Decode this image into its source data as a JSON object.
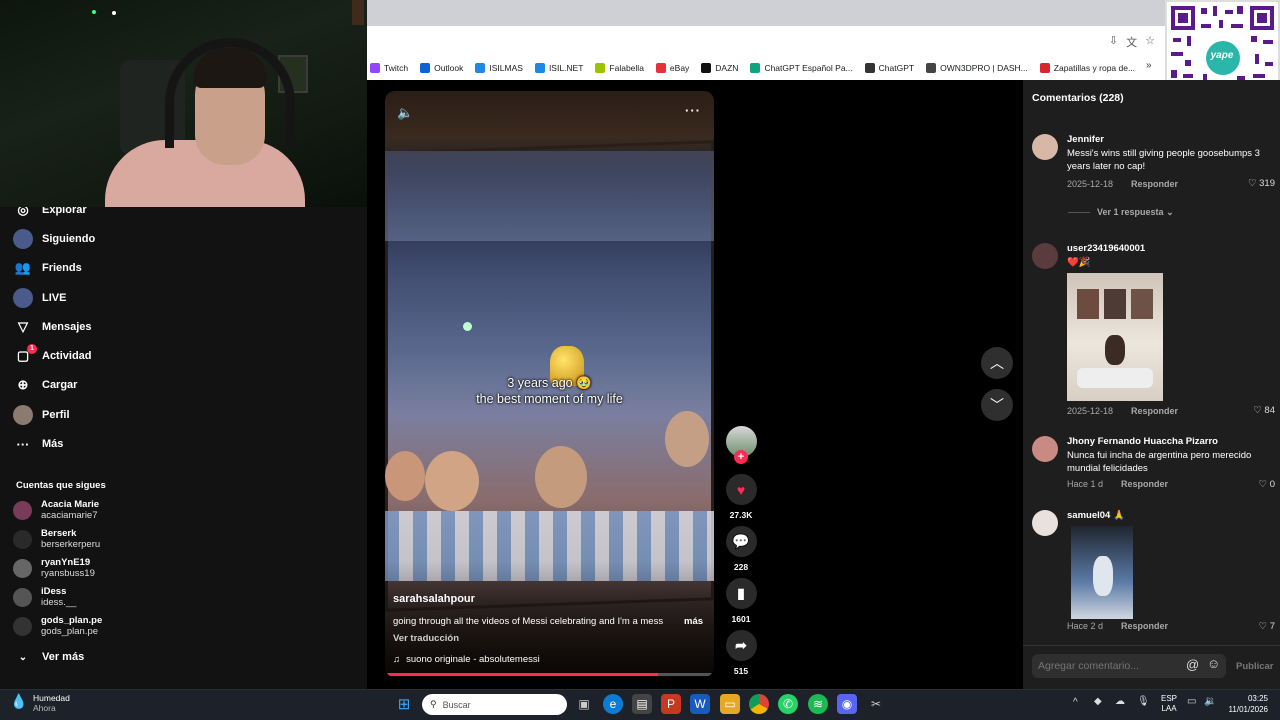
{
  "bookmarks": [
    {
      "label": "Twitch",
      "color": "#9146ff"
    },
    {
      "label": "Outlook",
      "color": "#0a64d4"
    },
    {
      "label": "ISILMAS",
      "color": "#1e88e5"
    },
    {
      "label": "ISIL.NET",
      "color": "#1e88e5"
    },
    {
      "label": "Falabella",
      "color": "#9bc400"
    },
    {
      "label": "eBay",
      "color": "#e53238"
    },
    {
      "label": "DAZN",
      "color": "#111111"
    },
    {
      "label": "ChatGPT Español Pa...",
      "color": "#10a37f"
    },
    {
      "label": "ChatGPT",
      "color": "#333333"
    },
    {
      "label": "OWN3DPRO | DASH...",
      "color": "#444444"
    },
    {
      "label": "Zapatillas y ropa de...",
      "color": "#d7262e"
    }
  ],
  "sidebar": {
    "nav": [
      {
        "label": "Explorar",
        "icon": "compass-icon"
      },
      {
        "label": "Siguiendo",
        "icon": "following-icon"
      },
      {
        "label": "Friends",
        "icon": "friends-icon"
      },
      {
        "label": "LIVE",
        "icon": "live-icon"
      },
      {
        "label": "Mensajes",
        "icon": "send-icon"
      },
      {
        "label": "Actividad",
        "icon": "activity-icon",
        "badge": "1"
      },
      {
        "label": "Cargar",
        "icon": "upload-icon"
      },
      {
        "label": "Perfil",
        "icon": "profile-icon"
      },
      {
        "label": "Más",
        "icon": "more-icon"
      }
    ],
    "following_title": "Cuentas que sigues",
    "following": [
      {
        "name": "Acacia Marie",
        "handle": "acaciamarie7"
      },
      {
        "name": "Berserk",
        "handle": "berserkerperu"
      },
      {
        "name": "ryanYnE19",
        "handle": "ryansbuss19"
      },
      {
        "name": "iDess",
        "handle": "idess.__"
      },
      {
        "name": "gods_plan.pe",
        "handle": "gods_plan.pe"
      }
    ],
    "see_more": "Ver más"
  },
  "video": {
    "caption_line1": "3 years ago 🥹",
    "caption_line2": "the best moment of my life",
    "author": "sarahsalahpour",
    "description": "going through all the videos of Messi celebrating and I'm a mess",
    "more": "más",
    "translate": "Ver traducción",
    "sound": "suono originale - absolutemessi",
    "progress": 0.83
  },
  "actions": {
    "likes": "27.3K",
    "comments": "228",
    "saves": "1601",
    "shares": "515"
  },
  "comments_panel": {
    "title": "Comentarios",
    "count": "(228)",
    "reply_label": "Responder",
    "view_replies": "Ver 1 respuesta",
    "input_placeholder": "Agregar comentario...",
    "publish": "Publicar",
    "items": [
      {
        "user": "Jennifer",
        "text": "Messi's wins still giving people goosebumps 3 years later no cap!",
        "date": "2025-12-18",
        "likes": "319"
      },
      {
        "user": "user23419640001",
        "text": "❤️🎉",
        "date": "2025-12-18",
        "likes": "84"
      },
      {
        "user": "Jhony Fernando Huaccha Pizarro",
        "text": "Nunca fui incha de argentina pero merecido mundial felicidades",
        "date": "Hace 1 d",
        "likes": "0"
      },
      {
        "user": "samuel04 🙏",
        "text": "",
        "date": "Hace 2 d",
        "likes": "7"
      }
    ]
  },
  "taskbar": {
    "weather_title": "Humedad",
    "weather_sub": "Ahora",
    "search_placeholder": "Buscar",
    "lang_top": "ESP",
    "lang_bottom": "LAA",
    "time": "03:25",
    "date": "11/01/2026"
  },
  "qr_brand": "yape"
}
